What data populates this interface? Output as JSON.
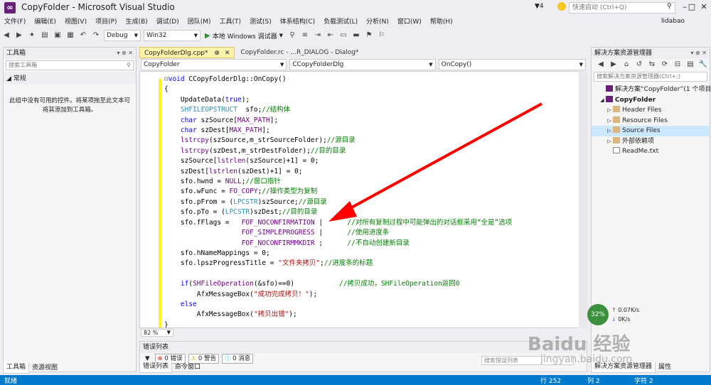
{
  "window": {
    "title": "CopyFolder - Microsoft Visual Studio",
    "notifications": "4",
    "quick_launch_placeholder": "快速启动 (Ctrl+Q)",
    "minimize": "–",
    "maximize": "□",
    "close": "✕"
  },
  "menu": {
    "items": [
      "文件(F)",
      "编辑(E)",
      "视图(V)",
      "项目(P)",
      "生成(B)",
      "调试(D)",
      "团队(M)",
      "工具(T)",
      "测试(S)",
      "体系结构(C)",
      "负载测试(L)",
      "分析(N)",
      "窗口(W)",
      "帮助(H)"
    ],
    "user": "lidabao"
  },
  "toolbar": {
    "config": "Debug",
    "platform": "Win32",
    "run_label": "本地 Windows 调试器"
  },
  "toolbox": {
    "title": "工具箱",
    "search_placeholder": "搜索工具箱",
    "group": "◢ 常规",
    "empty_text": "此组中没有可用的控件。将某项拖至此文本可将其添加到工具箱。",
    "tabs": [
      "工具箱",
      "资源视图"
    ]
  },
  "editor": {
    "tabs": [
      {
        "label": "CopyFolderDlg.cpp*",
        "pin": "⊕",
        "close": "✕"
      },
      {
        "label": "CopyFolder.rc - ...R_DIALOG - Dialog*"
      }
    ],
    "nav": {
      "project": "CopyFolder",
      "class": "CCopyFolderDlg",
      "member": "OnCopy()"
    },
    "zoom": "82 %"
  },
  "code": {
    "signature_kw": "void",
    "signature_rest": " CCopyFolderDlg::OnCopy()",
    "lines": [
      "{",
      "    UpdateData(true);",
      "    SHFILEOPSTRUCT  sfo;//结构体",
      "    char szSource[MAX_PATH];",
      "    char szDest[MAX_PATH];",
      "    lstrcpy(szSource,m_strSourceFolder);//源目录",
      "    lstrcpy(szDest,m_strDestFolder);//目的目录",
      "    szSource[lstrlen(szSource)+1] = 0;",
      "    szDest[lstrlen(szDest)+1] = 0;",
      "    sfo.hwnd = NULL;//窗口指针",
      "    sfo.wFunc = FO_COPY;//操作类型为复制",
      "    sfo.pFrom = (LPCSTR)szSource;//源目录",
      "    sfo.pTo = (LPCSTR)szDest;//目的目录",
      "    sfo.fFlags =   FOF_NOCONFIRMATION |      //对所有复制过程中可能弹出的对话框采用“全是”选项",
      "                   FOF_SIMPLEPROGRESS |      //使用进度条",
      "                   FOF_NOCONFIRMMKDIR ;      //不自动创建新目录",
      "    sfo.hNameMappings = 0;",
      "    sfo.lpszProgressTitle = \"文件夹拷贝\";//进度条的标题",
      "",
      "    if(SHFileOperation(&sfo)==0)           //拷贝成功，SHFileOperation返回0",
      "        AfxMessageBox(\"成功完成拷贝！\");",
      "    else",
      "        AfxMessageBox(\"拷贝出错\");",
      "}"
    ]
  },
  "error_list": {
    "title": "错误列表",
    "errors": "0 错误",
    "warnings": "0 警告",
    "messages": "0 消息",
    "search_placeholder": "搜索错误列表",
    "tabs": [
      "错误列表",
      "命令窗口"
    ]
  },
  "solution_explorer": {
    "title": "解决方案资源管理器",
    "search_placeholder": "搜索解决方案资源管理器(Ctrl+;)",
    "items": [
      {
        "label": "解决方案“CopyFolder”(1 个项目)",
        "indent": 0,
        "twisty": "",
        "icon": "sln"
      },
      {
        "label": "CopyFolder",
        "indent": 0,
        "twisty": "◢",
        "icon": "proj",
        "bold": true
      },
      {
        "label": "Header Files",
        "indent": 1,
        "twisty": "▷",
        "icon": "folder"
      },
      {
        "label": "Resource Files",
        "indent": 1,
        "twisty": "▷",
        "icon": "folder"
      },
      {
        "label": "Source Files",
        "indent": 1,
        "twisty": "▷",
        "icon": "folder",
        "selected": true
      },
      {
        "label": "外部依赖项",
        "indent": 1,
        "twisty": "▷",
        "icon": "folder"
      },
      {
        "label": "ReadMe.txt",
        "indent": 1,
        "twisty": "",
        "icon": "file"
      }
    ],
    "tabs": [
      "解决方案资源管理器",
      "属性"
    ]
  },
  "status_bar": {
    "ready": "就绪",
    "line": "行 252",
    "col": "列 2",
    "char": "字符 2"
  },
  "overlay": {
    "percent": "32%",
    "up_speed": "0.07K/s",
    "down_speed": "0K/s",
    "watermark": "Baidu 经验",
    "watermark_url": "jingyan.baidu.com"
  },
  "colors": {
    "accent": "#007acc",
    "arrow": "#ff0000",
    "keyword": "#0000ff",
    "comment": "#008000",
    "string": "#a31515"
  }
}
